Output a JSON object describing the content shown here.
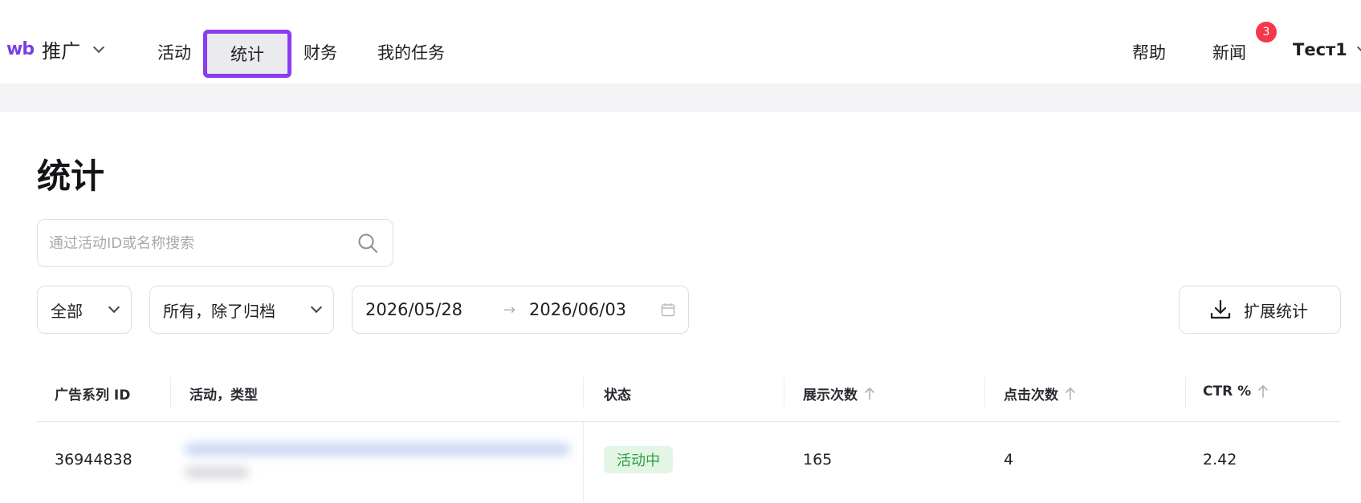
{
  "header": {
    "logo_mark": "wb",
    "logo_text": "推广",
    "nav": [
      "活动",
      "统计",
      "财务",
      "我的任务"
    ],
    "right_links": [
      "帮助",
      "新闻"
    ],
    "news_badge": "3",
    "user_name": "Тест1"
  },
  "page": {
    "title": "统计"
  },
  "search": {
    "placeholder": "通过活动ID或名称搜索",
    "value": ""
  },
  "filters": {
    "type_value": "全部",
    "status_value": "所有，除了归档",
    "date_from": "2026/05/28",
    "date_to": "2026/06/03",
    "date_arrow": "→",
    "export_label": "扩展统计"
  },
  "table": {
    "columns": [
      "广告系列 ID",
      "活动，类型",
      "状态",
      "展示次数",
      "点击次数",
      "CTR %"
    ],
    "rows": [
      {
        "id": "36944838",
        "status": "活动中",
        "impressions": "165",
        "clicks": "4",
        "ctr": "2.42"
      }
    ]
  },
  "colors": {
    "accent": "#8a3cf0",
    "brand": "#7b3fe4",
    "badge": "#f2384a",
    "status_active_bg": "#e3f5e5",
    "status_active_text": "#2f9e44"
  },
  "icons": [
    "chevron-down-icon",
    "search-icon",
    "calendar-icon",
    "download-icon",
    "sort-arrow-up-icon"
  ]
}
